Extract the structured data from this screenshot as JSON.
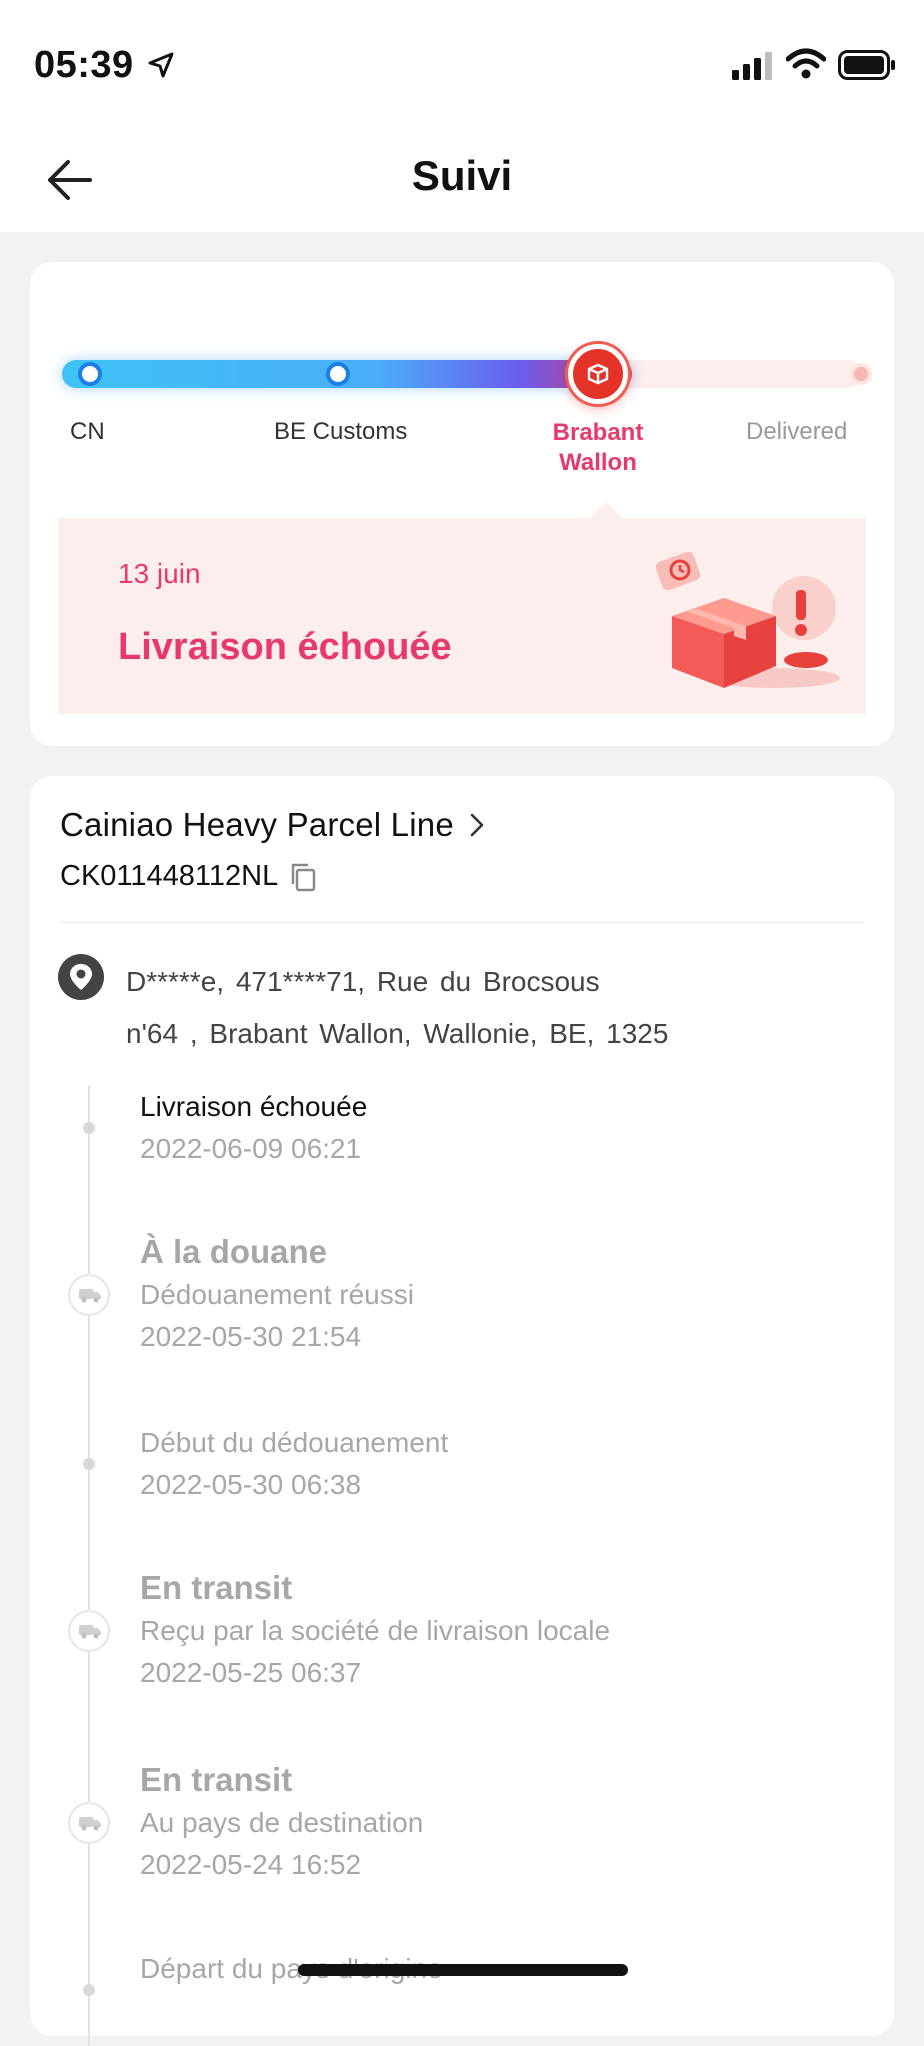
{
  "status_bar": {
    "time": "05:39"
  },
  "header": {
    "title": "Suivi"
  },
  "progress": {
    "steps": [
      {
        "label": "CN"
      },
      {
        "label": "BE Customs"
      },
      {
        "label_line1": "Brabant",
        "label_line2": "Wallon"
      },
      {
        "label": "Delivered"
      }
    ],
    "current_step_index": 2,
    "colors": {
      "done": "#1c7fe6",
      "current": "#e4342a",
      "accent_text": "#e83a6a"
    }
  },
  "status": {
    "date": "13 juin",
    "title": "Livraison échouée"
  },
  "shipment": {
    "carrier": "Cainiao Heavy Parcel Line",
    "tracking_number": "CK011448112NL",
    "address_line1": "D*****e,  471****71,  Rue du Brocsous",
    "address_line2": "n'64 ,  Brabant Wallon,  Wallonie,  BE,  1325"
  },
  "timeline": [
    {
      "heading": "",
      "desc": "Livraison échouée",
      "time": "2022-06-09 06:21"
    },
    {
      "heading": "À la douane",
      "desc": "Dédouanement réussi",
      "time": "2022-05-30 21:54"
    },
    {
      "heading": "",
      "desc": "Début du dédouanement",
      "time": "2022-05-30 06:38"
    },
    {
      "heading": "En transit",
      "desc": "Reçu par la société de livraison locale",
      "time": "2022-05-25 06:37"
    },
    {
      "heading": "En transit",
      "desc": "Au pays de destination",
      "time": "2022-05-24 16:52"
    },
    {
      "heading": "",
      "desc": "Départ du pays d'origine",
      "time": ""
    }
  ]
}
